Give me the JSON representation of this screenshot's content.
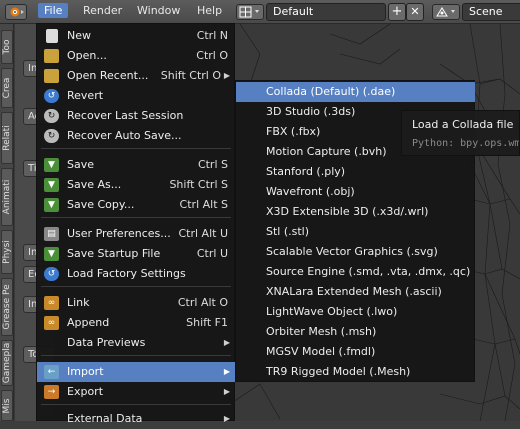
{
  "topbar": {
    "menus": [
      "File",
      "Render",
      "Window",
      "Help"
    ],
    "layout_name": "Default",
    "scene_name": "Scene",
    "add_symbol": "+",
    "close_symbol": "✕"
  },
  "left_tabs": [
    "Too",
    "Crea",
    "Relati",
    "Animati",
    "Physi",
    "Grease Pe",
    "Gamepla",
    "Mis"
  ],
  "tool_buttons": [
    "In",
    "Ac",
    "Ti",
    "In",
    "Ec",
    "In",
    "To"
  ],
  "file_menu": {
    "items": [
      {
        "label": "New",
        "shortcut": "Ctrl N",
        "icon": "new-file-icon"
      },
      {
        "label": "Open...",
        "shortcut": "Ctrl O",
        "icon": "open-folder-icon"
      },
      {
        "label": "Open Recent...",
        "shortcut": "Shift Ctrl O",
        "icon": "open-recent-icon",
        "submenu": true
      },
      {
        "label": "Revert",
        "shortcut": "",
        "icon": "revert-icon"
      },
      {
        "label": "Recover Last Session",
        "shortcut": "",
        "icon": "recover-icon"
      },
      {
        "label": "Recover Auto Save...",
        "shortcut": "",
        "icon": "recover-auto-icon"
      },
      {
        "label": "Save",
        "shortcut": "Ctrl S",
        "icon": "save-icon"
      },
      {
        "label": "Save As...",
        "shortcut": "Shift Ctrl S",
        "icon": "save-as-icon"
      },
      {
        "label": "Save Copy...",
        "shortcut": "Ctrl Alt S",
        "icon": "save-copy-icon"
      },
      {
        "label": "User Preferences...",
        "shortcut": "Ctrl Alt U",
        "icon": "preferences-icon"
      },
      {
        "label": "Save Startup File",
        "shortcut": "Ctrl U",
        "icon": "save-startup-icon"
      },
      {
        "label": "Load Factory Settings",
        "shortcut": "",
        "icon": "factory-settings-icon"
      },
      {
        "label": "Link",
        "shortcut": "Ctrl Alt O",
        "icon": "link-icon"
      },
      {
        "label": "Append",
        "shortcut": "Shift F1",
        "icon": "append-icon"
      },
      {
        "label": "Data Previews",
        "shortcut": "",
        "icon": "",
        "submenu": true
      },
      {
        "label": "Import",
        "shortcut": "",
        "icon": "import-icon",
        "submenu": true,
        "highlighted": true
      },
      {
        "label": "Export",
        "shortcut": "",
        "icon": "export-icon",
        "submenu": true
      },
      {
        "label": "External Data",
        "shortcut": "",
        "icon": "",
        "submenu": true
      }
    ]
  },
  "import_submenu": {
    "items": [
      {
        "label": "Collada (Default) (.dae)",
        "highlighted": true
      },
      {
        "label": "3D Studio (.3ds)"
      },
      {
        "label": "FBX (.fbx)"
      },
      {
        "label": "Motion Capture (.bvh)"
      },
      {
        "label": "Stanford (.ply)"
      },
      {
        "label": "Wavefront (.obj)"
      },
      {
        "label": "X3D Extensible 3D (.x3d/.wrl)"
      },
      {
        "label": "Stl (.stl)"
      },
      {
        "label": "Scalable Vector Graphics (.svg)"
      },
      {
        "label": "Source Engine (.smd, .vta, .dmx, .qc)"
      },
      {
        "label": "XNALara Extended Mesh (.ascii)"
      },
      {
        "label": "LightWave Object (.lwo)"
      },
      {
        "label": "Orbiter Mesh (.msh)"
      },
      {
        "label": "MGSV Model (.fmdl)"
      },
      {
        "label": "TR9 Rigged Model (.Mesh)"
      }
    ]
  },
  "tooltip": {
    "title": "Load a Collada file",
    "python": "Python: bpy.ops.wm"
  },
  "colors": {
    "highlight": "#5680c2",
    "menu_bg": "#161616",
    "topbar": "#4a4a4a"
  }
}
